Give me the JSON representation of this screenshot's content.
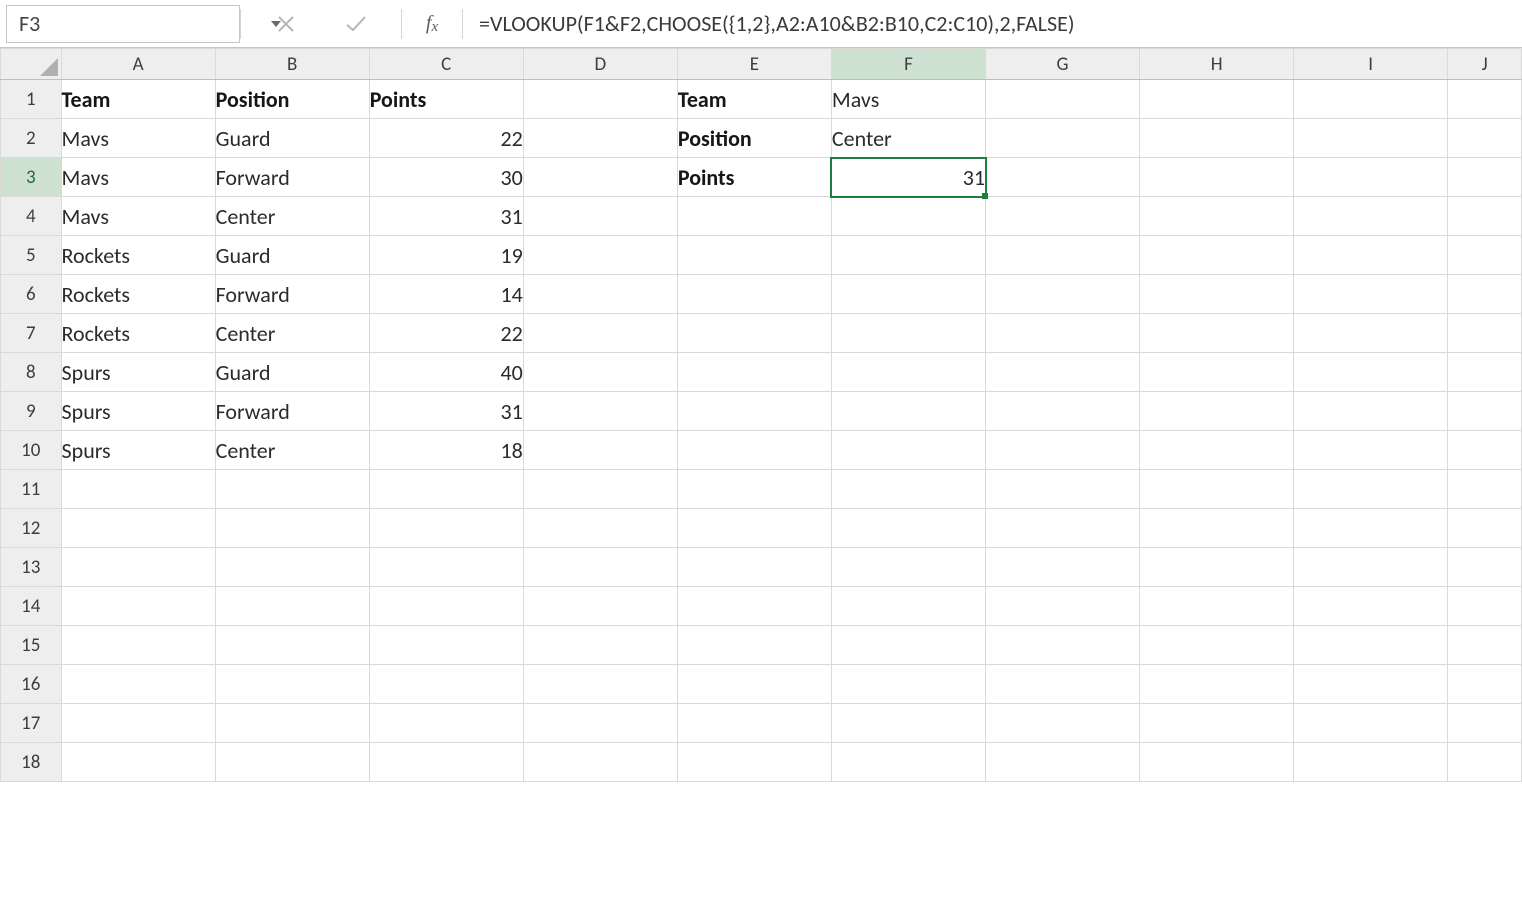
{
  "name_box": {
    "value": "F3"
  },
  "formula_bar": {
    "value": "=VLOOKUP(F1&F2,CHOOSE({1,2},A2:A10&B2:B10,C2:C10),2,FALSE)"
  },
  "columns": [
    "A",
    "B",
    "C",
    "D",
    "E",
    "F",
    "G",
    "H",
    "I",
    "J"
  ],
  "row_count": 18,
  "selected": {
    "col": "F",
    "row": 3
  },
  "cells": {
    "A1": {
      "v": "Team",
      "bold": true
    },
    "B1": {
      "v": "Position",
      "bold": true
    },
    "C1": {
      "v": "Points",
      "bold": true
    },
    "A2": {
      "v": "Mavs"
    },
    "B2": {
      "v": "Guard"
    },
    "C2": {
      "v": "22",
      "num": true
    },
    "A3": {
      "v": "Mavs"
    },
    "B3": {
      "v": "Forward"
    },
    "C3": {
      "v": "30",
      "num": true
    },
    "A4": {
      "v": "Mavs"
    },
    "B4": {
      "v": "Center"
    },
    "C4": {
      "v": "31",
      "num": true
    },
    "A5": {
      "v": "Rockets"
    },
    "B5": {
      "v": "Guard"
    },
    "C5": {
      "v": "19",
      "num": true
    },
    "A6": {
      "v": "Rockets"
    },
    "B6": {
      "v": "Forward"
    },
    "C6": {
      "v": "14",
      "num": true
    },
    "A7": {
      "v": "Rockets"
    },
    "B7": {
      "v": "Center"
    },
    "C7": {
      "v": "22",
      "num": true
    },
    "A8": {
      "v": "Spurs"
    },
    "B8": {
      "v": "Guard"
    },
    "C8": {
      "v": "40",
      "num": true
    },
    "A9": {
      "v": "Spurs"
    },
    "B9": {
      "v": "Forward"
    },
    "C9": {
      "v": "31",
      "num": true
    },
    "A10": {
      "v": "Spurs"
    },
    "B10": {
      "v": "Center"
    },
    "C10": {
      "v": "18",
      "num": true
    },
    "E1": {
      "v": "Team",
      "bold": true
    },
    "F1": {
      "v": "Mavs"
    },
    "E2": {
      "v": "Position",
      "bold": true
    },
    "F2": {
      "v": "Center"
    },
    "E3": {
      "v": "Points",
      "bold": true
    },
    "F3": {
      "v": "31",
      "num": true
    }
  },
  "col_widths": {
    "_rowh": 55,
    "A": 140,
    "B": 140,
    "C": 140,
    "D": 140,
    "E": 140,
    "F": 140,
    "G": 140,
    "H": 140,
    "I": 140,
    "J": 67
  }
}
